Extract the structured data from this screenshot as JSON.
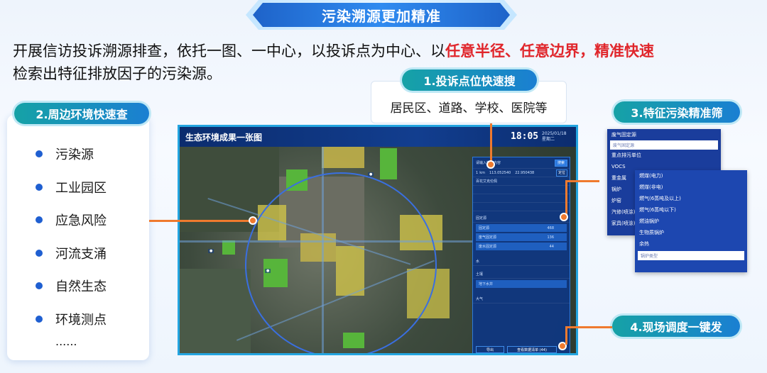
{
  "header": {
    "title": "污染溯源更加精准"
  },
  "intro": {
    "text_normal": "开展信访投诉溯源排查，依托一图、一中心，以投诉点为中心、以",
    "text_highlight": "任意半径、任意边界，精准快速",
    "text_line2": "检索出特征排放因子的污染源。"
  },
  "callouts": {
    "search": {
      "title": "1.投诉点位快速搜",
      "desc": "居民区、道路、学校、医院等"
    },
    "surround": {
      "title": "2.周边环境快速查",
      "items": [
        "污染源",
        "工业园区",
        "应急风险",
        "河流支涌",
        "自然生态",
        "环境测点"
      ],
      "more": "......"
    },
    "filter": {
      "title": "3.特征污染精准筛"
    },
    "dispatch": {
      "title": "4.现场调度一键发"
    }
  },
  "map": {
    "title": "生态环境成果一张图",
    "time": "18:05",
    "date": "2025/01/18",
    "weekday": "星期二"
  },
  "control_panel": {
    "search_placeholder": "请输入搜索内容",
    "search_btn": "搜索",
    "distance_value": "1",
    "distance_unit": "km",
    "coord1": "113.052540",
    "coord2": "22.950438",
    "locate_btn": "定位",
    "keyword": "百花艾克伦佩",
    "sections": [
      "固定源",
      "水",
      "土壤",
      "大气"
    ],
    "rows": [
      {
        "label": "固定源",
        "value": "468"
      },
      {
        "label": "废气固定源",
        "value": "136"
      },
      {
        "label": "废水固定源",
        "value": "44"
      }
    ],
    "soil_row": "地下水井",
    "bottom_btns": [
      "导出",
      "查看数据清单 (44)"
    ]
  },
  "dropdown1": {
    "header": "废气固定源",
    "selected": "废气固定源",
    "options": [
      "重点排污单位",
      "VOCS",
      "重金属",
      "锅炉",
      "炉窑",
      "汽修(喷涂)",
      "家具(喷涂)"
    ]
  },
  "dropdown2": {
    "options": [
      "燃煤(电力)",
      "燃煤(非电)",
      "燃气(6蒸吨及以上)",
      "燃气(6蒸吨以下)",
      "燃油锅炉",
      "生物质锅炉",
      "余热"
    ],
    "selected": "锅炉类型"
  },
  "colors": {
    "accent": "#1f63c9",
    "highlight": "#e0262b",
    "connector": "#ef7a2e"
  }
}
